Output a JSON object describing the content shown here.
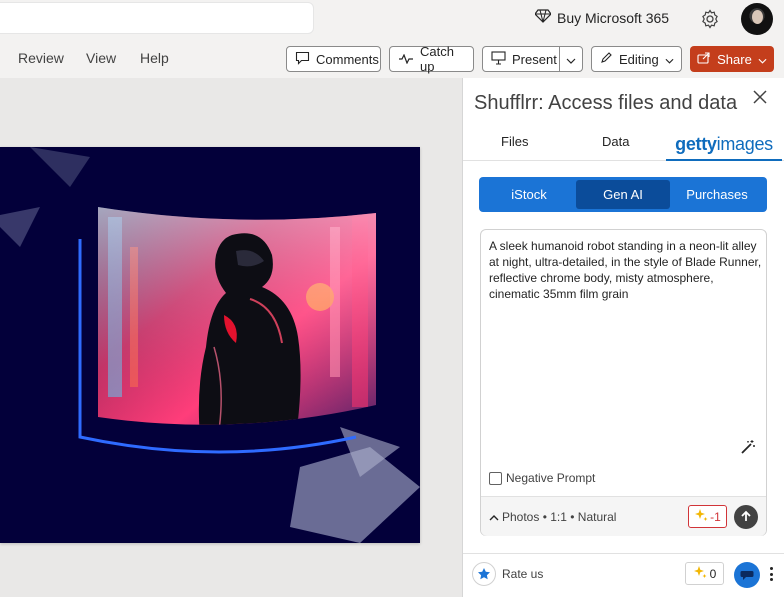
{
  "header": {
    "buy_label": "Buy Microsoft 365"
  },
  "menubar": {
    "items": [
      "Review",
      "View",
      "Help"
    ],
    "comments_label": "Comments",
    "catchup_label": "Catch up",
    "present_label": "Present",
    "editing_label": "Editing",
    "share_label": "Share"
  },
  "pane": {
    "title": "Shufflrr: Access files and data",
    "tabs": {
      "files": "Files",
      "data": "Data",
      "getty_prefix": "getty",
      "getty_suffix": "images"
    },
    "segments": [
      "iStock",
      "Gen AI",
      "Purchases"
    ],
    "active_segment": "Gen AI",
    "prompt": "A sleek humanoid robot standing in a neon-lit alley at night, ultra-detailed, in the style of Blade Runner, reflective chrome body, misty atmosphere, cinematic 35mm film grain",
    "negative_prompt_label": "Negative Prompt",
    "negative_prompt_checked": false,
    "options_label": "Photos • 1:1 • Natural",
    "credit_cost": "-1",
    "footer": {
      "rate_label": "Rate us",
      "credits": "0"
    }
  },
  "colors": {
    "share": "#c43e1c",
    "getty_blue": "#0f6cbd",
    "segment_blue": "#1b74d6",
    "segment_active": "#0b4c9a",
    "slide_bg": "#03003a",
    "credit_red": "#d13438"
  },
  "icons": [
    "diamond-icon",
    "gear-icon",
    "comment-icon",
    "catchup-icon",
    "present-icon",
    "chevron-down-icon",
    "pencil-icon",
    "share-icon",
    "close-icon",
    "magic-wand-icon",
    "sparkle-icon",
    "arrow-up-icon",
    "star-icon",
    "chat-icon",
    "more-icon"
  ]
}
